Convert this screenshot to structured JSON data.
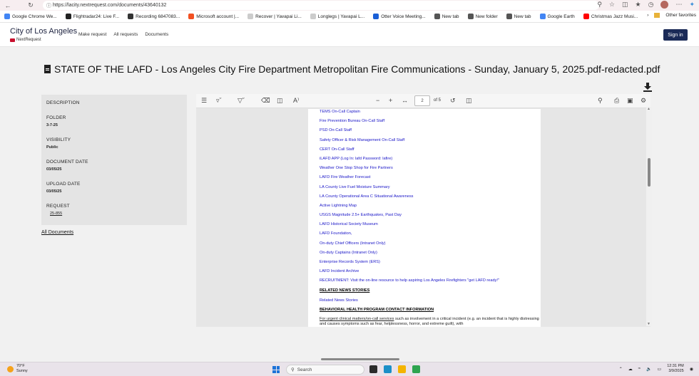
{
  "browser": {
    "url": "https://lacity.nextrequest.com/documents/43640132",
    "bookmarks": [
      {
        "label": "Google Chrome We...",
        "color": "#4285f4"
      },
      {
        "label": "Flightradar24: Live F...",
        "color": "#222222"
      },
      {
        "label": "Recording 6847083...",
        "color": "#333333"
      },
      {
        "label": "Microsoft account |...",
        "color": "#f25022"
      },
      {
        "label": "Recover | Yavapai Li...",
        "color": "#cccccc"
      },
      {
        "label": "Longlegs | Yavapai L...",
        "color": "#cccccc"
      },
      {
        "label": "Otter Voice Meeting...",
        "color": "#1a5fd6"
      },
      {
        "label": "New tab",
        "color": "#555555"
      },
      {
        "label": "New folder",
        "color": "#555555"
      },
      {
        "label": "New tab",
        "color": "#555555"
      },
      {
        "label": "Google Earth",
        "color": "#4285f4"
      },
      {
        "label": "Christmas Jazz Musi...",
        "color": "#ff0000"
      }
    ],
    "other_favorites": "Other favorites"
  },
  "site": {
    "city_name": "City of Los Angeles",
    "brand": "NextRequest",
    "nav": [
      "Make request",
      "All requests",
      "Documents"
    ],
    "signin": "Sign in"
  },
  "document": {
    "title": "STATE OF THE LAFD - Los Angeles City Fire Department Metropolitan Fire Communications - Sunday, January 5, 2025.pdf-redacted.pdf"
  },
  "meta": {
    "description_label": "DESCRIPTION",
    "folder_label": "FOLDER",
    "folder_value": "3-7-25",
    "visibility_label": "VISIBILITY",
    "visibility_value": "Public",
    "document_date_label": "DOCUMENT DATE",
    "document_date_value": "03/05/25",
    "upload_date_label": "UPLOAD DATE",
    "upload_date_value": "03/05/25",
    "request_label": "REQUEST",
    "request_value": "25-855",
    "all_documents": "All Documents"
  },
  "viewer": {
    "page_number": "2",
    "page_of": "of 5"
  },
  "pdf": {
    "lines": [
      {
        "type": "link",
        "text": "TEMS On-Call Captain"
      },
      {
        "type": "link",
        "text": "Fire Prevention Bureau On-Call Staff"
      },
      {
        "type": "link",
        "text": "PSD On-Call Staff"
      },
      {
        "type": "link",
        "text": "Safety Officer & Risk Management On-Call Staff"
      },
      {
        "type": "link",
        "text": "CERT On-Call Staff"
      },
      {
        "type": "link",
        "text": "iLAFD APP (Log In: lafd Password: lafire)"
      },
      {
        "type": "link",
        "text": "Weather One Stop Shop for Fire Partners"
      },
      {
        "type": "link",
        "text": "LAFD Fire Weather Forecast"
      },
      {
        "type": "link",
        "text": "LA County Live Fuel Moisture Summary"
      },
      {
        "type": "link",
        "text": "LA County Operational Area C Situational Awareness"
      },
      {
        "type": "link",
        "text": "Active Lightning Map"
      },
      {
        "type": "link",
        "text": "USGS Magnitude 2.5+ Earthquakes, Past Day"
      },
      {
        "type": "link",
        "text": "LAFD Historical Society Museum"
      },
      {
        "type": "link",
        "text": "LAFD Foundation,"
      },
      {
        "type": "link",
        "text": "On-duty Chief Officers (Intranet Only)"
      },
      {
        "type": "link",
        "text": "On-duty Captains (Intranet Only)"
      },
      {
        "type": "link",
        "text": "Enterprise Records System (ERS)"
      },
      {
        "type": "link",
        "text": "LAFD Incident Archive"
      },
      {
        "type": "link",
        "text": "RECRUITMENT:  Visit the on-line resource to help aspiring Los Angeles Firefighters \"get LAFD ready!\""
      },
      {
        "type": "header",
        "text": "RELATED NEWS STORIES"
      },
      {
        "type": "link",
        "text": "Related News Stories"
      },
      {
        "type": "header",
        "text": "BEHAVIORAL HEALTH PROGRAM CONTACT INFORMATION"
      }
    ],
    "para_underlined": "For urgent clinical matters/on-call services",
    "para_rest": " such as involvement in a critical incident (e.g. an incident that is highly distressing and causes symptoms such as fear, helplessness, horror, and extreme guilt), with"
  },
  "taskbar": {
    "temp": "70°F",
    "condition": "Sunny",
    "search": "Search",
    "time": "12:31 PM",
    "date": "3/9/2025"
  }
}
